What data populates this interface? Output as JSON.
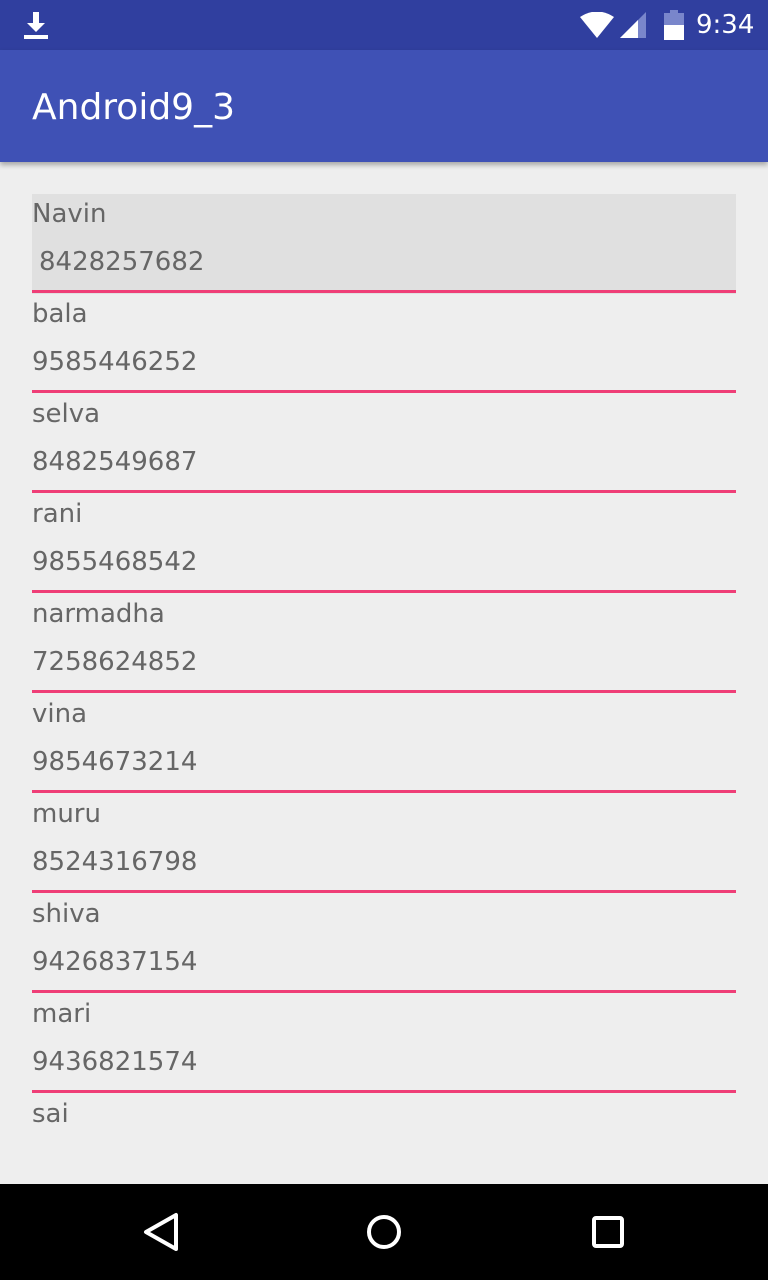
{
  "status_bar": {
    "time": "9:34",
    "icons": [
      "download-icon",
      "wifi-icon",
      "cell-signal-icon",
      "battery-icon"
    ]
  },
  "app_bar": {
    "title": "Android9_3",
    "color": "#3f51b5"
  },
  "contacts": [
    {
      "name": "Navin",
      "phone": "8428257682",
      "selected": true
    },
    {
      "name": "bala",
      "phone": "9585446252"
    },
    {
      "name": "selva",
      "phone": "8482549687"
    },
    {
      "name": "rani",
      "phone": "9855468542"
    },
    {
      "name": "narmadha",
      "phone": "7258624852"
    },
    {
      "name": "vina",
      "phone": "9854673214"
    },
    {
      "name": "muru",
      "phone": "8524316798"
    },
    {
      "name": "shiva",
      "phone": "9426837154"
    },
    {
      "name": "mari",
      "phone": "9436821574"
    },
    {
      "name": "sai",
      "phone": ""
    }
  ],
  "divider_color": "#ef3e77",
  "nav_bar": {
    "buttons": [
      "back-icon",
      "home-icon",
      "recents-icon"
    ]
  }
}
